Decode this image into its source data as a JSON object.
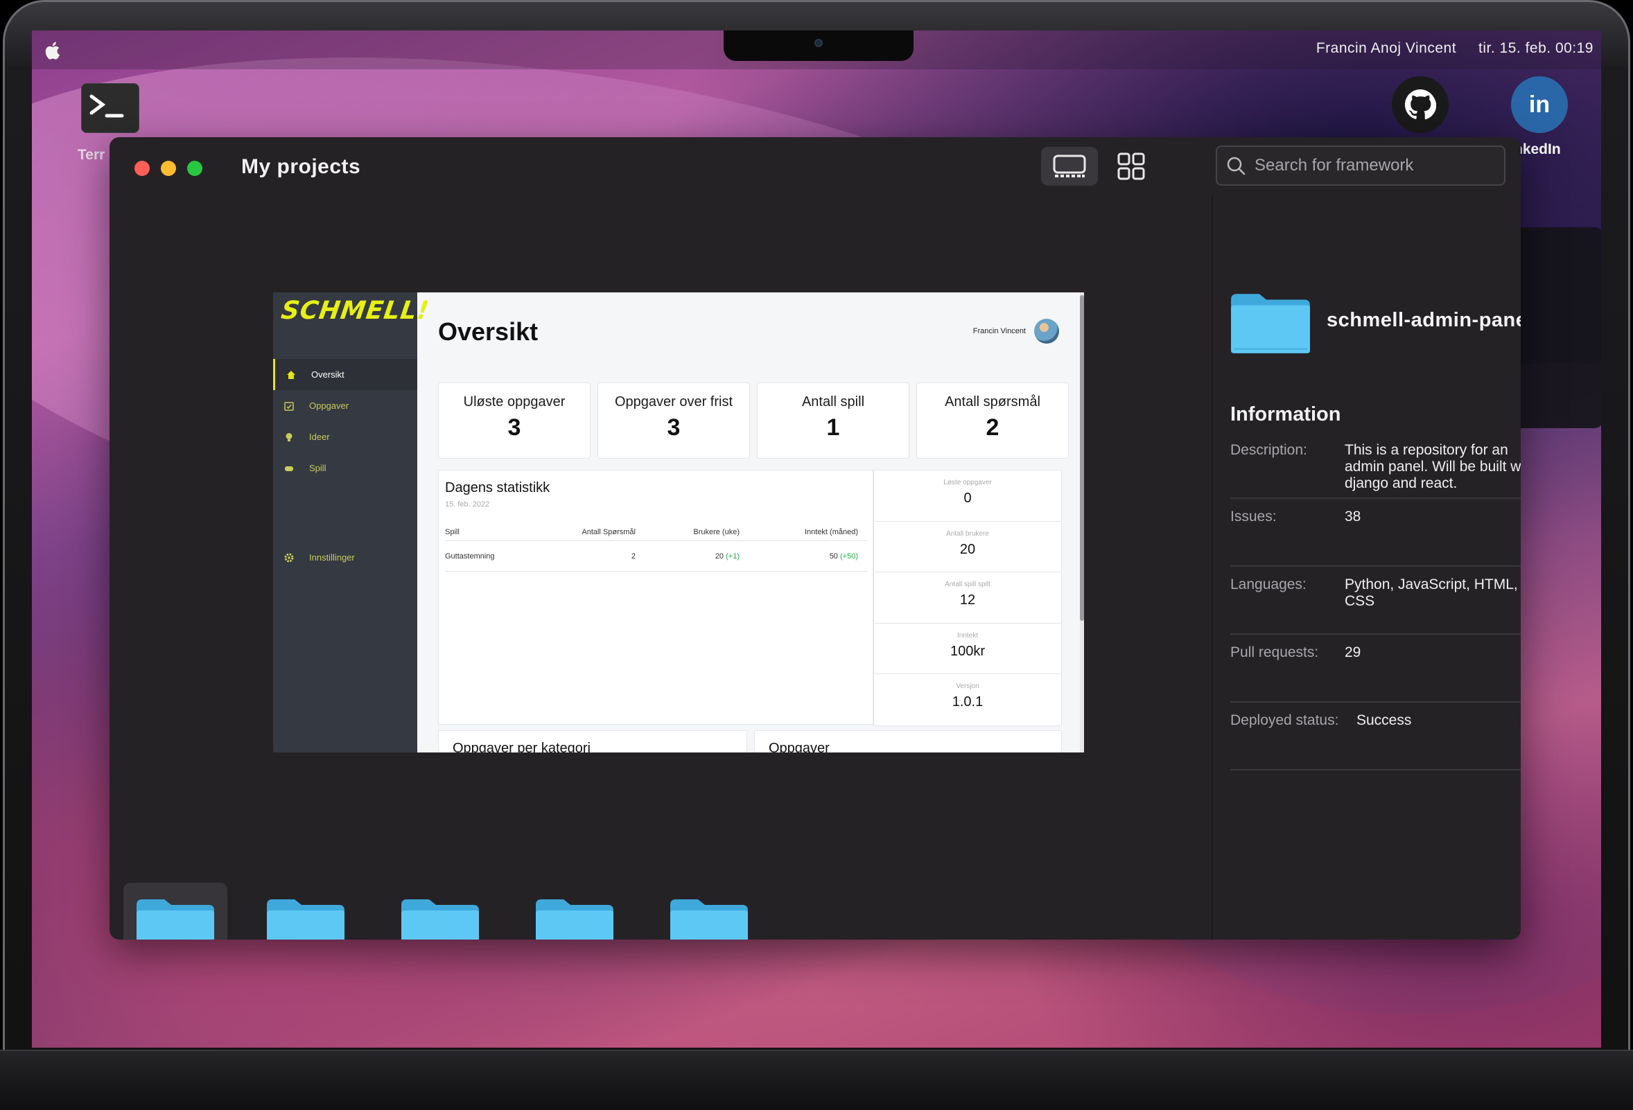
{
  "menubar": {
    "user": "Francin Anoj Vincent",
    "datetime": "tir. 15. feb. 00:19"
  },
  "desktop": {
    "terminal_label": "Terr",
    "linkedin_label": "nkedIn",
    "linkedin_glyph": "in"
  },
  "window": {
    "title": "My projects",
    "search_placeholder": "Search for framework"
  },
  "preview": {
    "logo": "SCHMELL!",
    "nav": [
      "Oversikt",
      "Oppgaver",
      "Ideer",
      "Spill"
    ],
    "settings": "Innstillinger",
    "heading": "Oversikt",
    "user": "Francin Vincent",
    "cards": [
      {
        "label": "Uløste oppgaver",
        "value": "3"
      },
      {
        "label": "Oppgaver over frist",
        "value": "3"
      },
      {
        "label": "Antall spill",
        "value": "1"
      },
      {
        "label": "Antall spørsmål",
        "value": "2"
      }
    ],
    "stats_title": "Dagens statistikk",
    "stats_date": "15. feb. 2022",
    "table_headers": [
      "Spill",
      "Antall Spørsmål",
      "Brukere (uke)",
      "Inntekt (måned)"
    ],
    "table_row": {
      "spill": "Guttastemning",
      "questions": "2",
      "users": "20",
      "users_delta": "(+1)",
      "income": "50",
      "income_delta": "(+50)"
    },
    "side_stats": [
      {
        "label": "Løste oppgaver",
        "value": "0"
      },
      {
        "label": "Antall brukere",
        "value": "20"
      },
      {
        "label": "Antall spill spilt",
        "value": "12"
      },
      {
        "label": "Inntekt",
        "value": "100kr"
      },
      {
        "label": "Versjon",
        "value": "1.0.1"
      }
    ],
    "bottom_cards": [
      "Oppgaver per kategori",
      "Oppgaver"
    ]
  },
  "project": {
    "name": "schmell-admin-panel",
    "info_heading": "Information",
    "description_label": "Description:",
    "description": "This is a repository for an admin panel. Will be built with django and react.",
    "issues_label": "Issues:",
    "issues": "38",
    "languages_label": "Languages:",
    "languages": "Python, JavaScript, HTML, CSS",
    "pull_requests_label": "Pull requests:",
    "pull_requests": "29",
    "deployed_label": "Deployed status:",
    "deployed": "Success"
  },
  "folders_count": 5,
  "colors": {
    "folder": "#5ec8f5",
    "folder_tab": "#3fa9dc",
    "window_bg": "#252226",
    "accent_logo": "#e6f014"
  }
}
